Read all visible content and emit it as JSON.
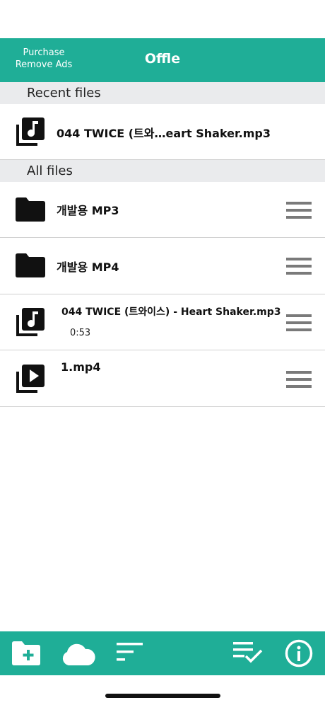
{
  "header": {
    "purchase_line1": "Purchase",
    "purchase_line2": "Remove Ads",
    "title": "Offle"
  },
  "recent": {
    "section_title": "Recent files",
    "items": [
      {
        "name": "044 TWICE (트와…eart Shaker.mp3",
        "icon": "music-library-icon"
      }
    ]
  },
  "all": {
    "section_title": "All files",
    "items": [
      {
        "name": "개발용 MP3",
        "icon": "folder-icon",
        "sub": ""
      },
      {
        "name": "개발용 MP4",
        "icon": "folder-icon",
        "sub": ""
      },
      {
        "name": "044 TWICE (트와이스) - Heart Shaker.mp3",
        "icon": "music-library-icon",
        "sub": "0:53"
      },
      {
        "name": "1.mp4",
        "icon": "video-library-icon",
        "sub": ""
      }
    ]
  },
  "toolbar": {
    "buttons": [
      "new-folder-icon",
      "cloud-icon",
      "sort-icon",
      "select-list-icon",
      "info-icon"
    ]
  },
  "colors": {
    "accent": "#1fae97",
    "section_bg": "#eaebed"
  }
}
